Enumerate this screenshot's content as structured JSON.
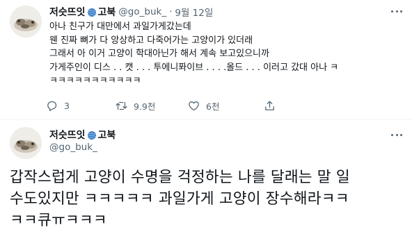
{
  "tweet1": {
    "display_name": "저슷뜨잇",
    "display_name_suffix": "고북",
    "handle": "@go_buk_",
    "separator": "·",
    "date": "9월 12일",
    "lines": [
      "아나 친구가 대만에서 과일가게갔는데",
      "웬 진짜 뼈가 다 앙상하고 다죽어가는 고양이가 있더래",
      "그래서 아 이거 고양이 학대아닌가 해서 계속 보고있으니까",
      "가게주인이  디스 . .  캣 . . . 투에니퐈이브 . . . .올드 . . . 이러고 갔대 아나 ㅋ",
      "ㅋㅋㅋㅋㅋㅋㅋㅋㅋㅋㅋ"
    ],
    "actions": {
      "reply_count": "3",
      "retweet_count": "9.9천",
      "like_count": "6천"
    }
  },
  "tweet2": {
    "display_name": "저슷뜨잇",
    "display_name_suffix": "고북",
    "handle": "@go_buk_",
    "lines": [
      "갑작스럽게 고양이 수명을 걱정하는 나를 달래는 말 일",
      "수도있지만 ㅋㅋㅋㅋㅋ 과일가게 고양이 장수해라ㅋㅋ",
      "ㅋㅋ큐ㅠㅋㅋㅋ"
    ]
  },
  "icons": {
    "yarn": "yarn-ball-icon",
    "reply": "reply-icon",
    "retweet": "retweet-icon",
    "like": "heart-icon",
    "share": "share-icon",
    "more": "more-icon"
  },
  "colors": {
    "text": "#0f1419",
    "secondary": "#536471",
    "yarn_blue": "#3a7cc4",
    "divider": "#eff3f4"
  }
}
